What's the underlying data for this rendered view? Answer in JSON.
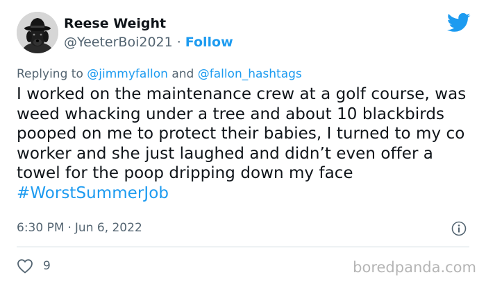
{
  "author": {
    "name": "Reese Weight",
    "handle": "@YeeterBoi2021",
    "separator": "·",
    "follow_label": "Follow"
  },
  "reply": {
    "prefix": "Replying to",
    "mention1": "@jimmyfallon",
    "conjunction": "and",
    "mention2": "@fallon_hashtags"
  },
  "tweet": {
    "text": "I worked on the maintenance crew at a golf course, was weed whacking under a tree and about 10 blackbirds pooped on me to protect their babies, I turned to my co worker and she just laughed and didn’t even offer a towel for the poop dripping down my face",
    "hashtag": "#WorstSummerJob"
  },
  "meta": {
    "time": "6:30 PM",
    "separator": "·",
    "date": "Jun 6, 2022"
  },
  "engagement": {
    "likes": "9"
  },
  "watermark": "boredpanda.com",
  "colors": {
    "accent": "#1d9bf0",
    "secondary_text": "#536471",
    "primary_text": "#0f1419"
  },
  "icons": {
    "brand": "twitter-bird-icon",
    "info": "info-icon",
    "like": "heart-icon"
  }
}
